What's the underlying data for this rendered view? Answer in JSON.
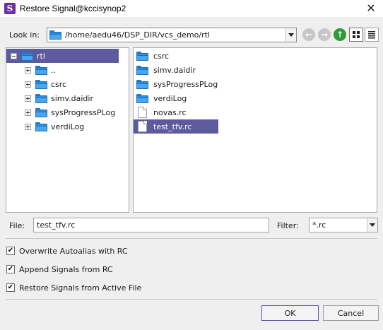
{
  "window": {
    "title": "Restore Signal@kccisynop2",
    "close_glyph": "✕"
  },
  "lookin": {
    "label": "Look in:",
    "path": "/home/aedu46/DSP_DIR/vcs_demo/rtl",
    "back_glyph": "←",
    "forward_glyph": "→",
    "up_glyph": "↑"
  },
  "tree": [
    {
      "label": "rtl",
      "selected": true,
      "expander": "minus"
    },
    {
      "label": "..",
      "selected": false,
      "expander": "plus"
    },
    {
      "label": "csrc",
      "selected": false,
      "expander": "plus"
    },
    {
      "label": "simv.daidir",
      "selected": false,
      "expander": "plus"
    },
    {
      "label": "sysProgressPLog",
      "selected": false,
      "expander": "plus"
    },
    {
      "label": "verdiLog",
      "selected": false,
      "expander": "plus"
    }
  ],
  "files": [
    {
      "label": "csrc",
      "kind": "folder",
      "selected": false
    },
    {
      "label": "simv.daidir",
      "kind": "folder",
      "selected": false
    },
    {
      "label": "sysProgressPLog",
      "kind": "folder",
      "selected": false
    },
    {
      "label": "verdiLog",
      "kind": "folder",
      "selected": false
    },
    {
      "label": "novas.rc",
      "kind": "file",
      "selected": false
    },
    {
      "label": "test_tfv.rc",
      "kind": "file",
      "selected": true
    }
  ],
  "file_field": {
    "label": "File:",
    "value": "test_tfv.rc"
  },
  "filter_field": {
    "label": "Filter:",
    "value": "*.rc"
  },
  "options": {
    "overwrite": {
      "label": "Overwrite Autoalias with RC",
      "checked": true
    },
    "append": {
      "label": "Append Signals from RC",
      "checked": true
    },
    "restore": {
      "label": "Restore Signals from Active File",
      "checked": true
    }
  },
  "buttons": {
    "ok": "OK",
    "cancel": "Cancel"
  },
  "colors": {
    "selection": "#5e5a9e",
    "folder": "#2b8fe0",
    "app_icon": "#6a2fa0"
  }
}
